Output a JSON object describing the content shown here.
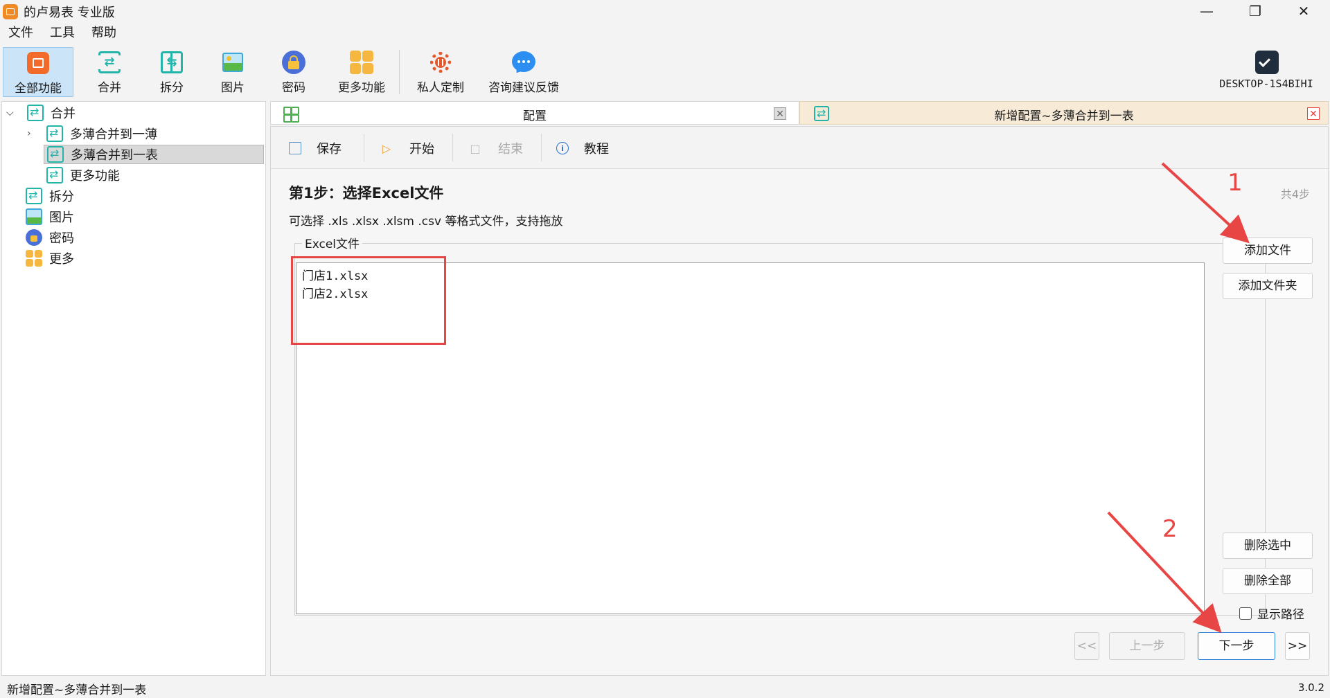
{
  "window": {
    "title": "的卢易表 专业版",
    "minimize_glyph": "—",
    "restore_glyph": "❐",
    "close_glyph": "✕"
  },
  "menu": [
    "文件",
    "工具",
    "帮助"
  ],
  "toolbar": {
    "items": [
      {
        "label": "全部功能",
        "icon": "all-functions-icon"
      },
      {
        "label": "合并",
        "icon": "merge-icon"
      },
      {
        "label": "拆分",
        "icon": "split-icon"
      },
      {
        "label": "图片",
        "icon": "image-icon"
      },
      {
        "label": "密码",
        "icon": "lock-icon"
      },
      {
        "label": "更多功能",
        "icon": "more-functions-icon"
      },
      {
        "label": "私人定制",
        "icon": "custom-icon"
      },
      {
        "label": "咨询建议反馈",
        "icon": "feedback-icon"
      }
    ],
    "account_label": "DESKTOP-1S4BIHI",
    "accent_color": "#22b3a9"
  },
  "tree": {
    "root": "合并",
    "children": [
      "多薄合并到一薄",
      "多薄合并到一表",
      "更多功能"
    ],
    "selected": "多薄合并到一表",
    "others": [
      "拆分",
      "图片",
      "密码",
      "更多"
    ]
  },
  "tabs": [
    {
      "title": "配置"
    },
    {
      "title": "新增配置~多薄合并到一表"
    }
  ],
  "actions": {
    "save": "保存",
    "start": "开始",
    "stop": "结束",
    "tutorial": "教程"
  },
  "step": {
    "title": "第1步：选择Excel文件",
    "total": "共4步",
    "description": "可选择 .xls  .xlsx  .xlsm  .csv 等格式文件，支持拖放"
  },
  "file_group": {
    "legend": "Excel文件",
    "files": [
      "门店1.xlsx",
      "门店2.xlsx"
    ]
  },
  "side_buttons": {
    "add_file": "添加文件",
    "add_folder": "添加文件夹",
    "delete_selected": "删除选中",
    "delete_all": "删除全部",
    "show_path": "显示路径"
  },
  "nav": {
    "first": "<<",
    "prev": "上一步",
    "next": "下一步",
    "last": ">>"
  },
  "annotations": {
    "num1": "1",
    "num2": "2",
    "color": "#e84545"
  },
  "status": {
    "text": "新增配置~多薄合并到一表",
    "version": "3.0.2"
  }
}
